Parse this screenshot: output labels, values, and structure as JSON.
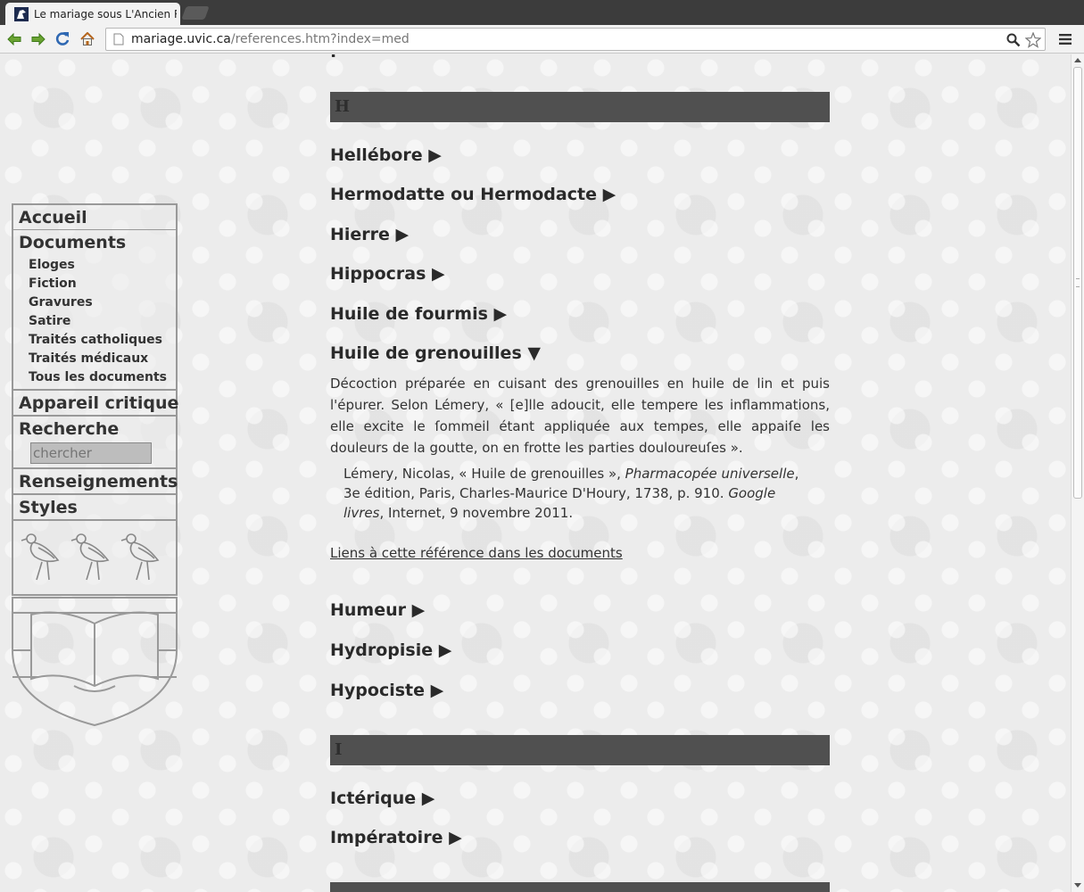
{
  "browser": {
    "tab_title": "Le mariage sous L'Ancien Régime",
    "url_host": "mariage.uvic.ca",
    "url_path": "/references.htm?index=med"
  },
  "sidebar": {
    "items": {
      "accueil": "Accueil",
      "documents": "Documents",
      "appareil": "Appareil critique",
      "recherche": "Recherche",
      "renseignements": "Renseignements",
      "styles": "Styles"
    },
    "documents_sub": [
      "Eloges",
      "Fiction",
      "Gravures",
      "Satire",
      "Traités catholiques",
      "Traités médicaux",
      "Tous les documents"
    ],
    "search_placeholder": "chercher"
  },
  "main": {
    "sections": [
      {
        "letter": "H",
        "entries": [
          {
            "label": "Hellébore ▶"
          },
          {
            "label": "Hermodatte ou Hermodacte ▶"
          },
          {
            "label": "Hierre ▶"
          },
          {
            "label": "Hippocras ▶"
          },
          {
            "label": "Huile de fourmis ▶"
          },
          {
            "label": "Huile de grenouilles ▼"
          },
          {
            "label": "Humeur ▶"
          },
          {
            "label": "Hydropisie ▶"
          },
          {
            "label": "Hypociste ▶"
          }
        ]
      },
      {
        "letter": "I",
        "entries": [
          {
            "label": "Ictérique ▶"
          },
          {
            "label": "Impératoire ▶"
          }
        ]
      }
    ],
    "expanded": {
      "definition": "Décoction préparée en cuisant des grenouilles en huile de lin et puis l'épurer. Selon Lémery, « [e]lle adoucit, elle tempere les inflammations, elle excite le ſommeil étant appliquée aux tempes, elle appaiſe les douleurs de la goutte, on en frotte les parties douloureuſes ».",
      "citation_author": "Lémery, Nicolas, « Huile de grenouilles », ",
      "citation_work": "Pharmacopée universelle",
      "citation_details": ", 3e édition, Paris, Charles-Maurice D'Houry, 1738, p. 910. ",
      "citation_source": "Google livres",
      "citation_access": ", Internet, 9 novembre 2011.",
      "links_label": "Liens à cette référence dans les documents"
    }
  }
}
